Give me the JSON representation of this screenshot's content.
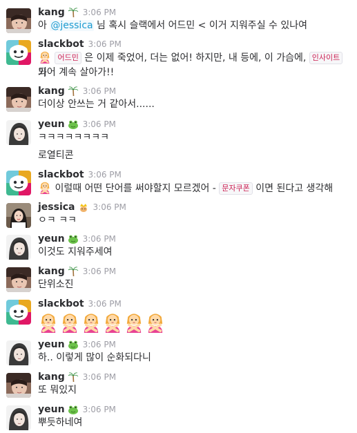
{
  "users": {
    "kang": "kang",
    "slackbot": "slackbot",
    "yeun": "yeun",
    "jessica": "jessica"
  },
  "time": "3:06 PM",
  "messages": {
    "m1": {
      "pre": "아 ",
      "mention": "@jessica",
      "post": " 님 혹시 슬랙에서 어드민 < 이거 지워주실 수 있나여"
    },
    "m2": {
      "code1": "어드민",
      "mid": " 은 이제 죽었어, 더는 없어! 하지만, 내 등에, 이 가슴에, ",
      "code2": "인사이트",
      "end": " 가",
      "line2": "되어 계속 살아가!!"
    },
    "m3": "더이상 안쓰는 거 같아서......",
    "m4": "ㅋㅋㅋㅋㅋㅋㅋㅋ",
    "m5": "로열티콘",
    "m6": {
      "pre": " 이럴때 어떤 단어를 써야할지 모르겠어 - ",
      "code": "문자쿠폰",
      "post": " 이면 된다고 생각해"
    },
    "m7": "ㅇㅋ ㅋㅋ",
    "m8": "이것도 지워주세여",
    "m9": "단위소진",
    "m11": "하.. 이렇게 많이 순화되다니",
    "m12": "또 뭐있지",
    "m13": "뿌듯하네여"
  },
  "icons": {
    "kang_status": "palm-tree-icon",
    "yeun_status": "frog-icon",
    "jessica_status": "crown-cat-icon",
    "gesture": "no-good-gesture-emoji"
  },
  "colors": {
    "mention_text": "#1d9bd1",
    "code_text": "#cc2255",
    "timestamp": "#9e9ea6"
  }
}
